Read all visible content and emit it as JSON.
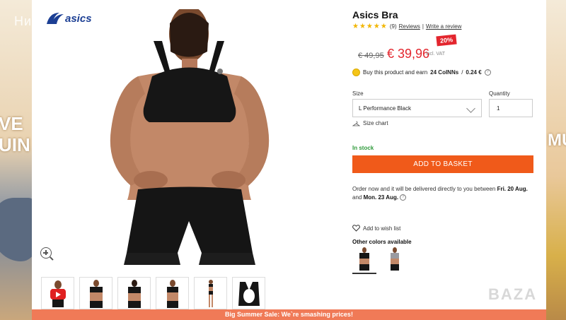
{
  "side_banners": {
    "left_promo_text": "VE\nUIN B",
    "right_promo_text": "MU"
  },
  "watermark_top_left": "Ни...",
  "watermark_bottom_right": "BAZA",
  "product": {
    "title": "Asics Bra",
    "rating_stars": "★★★★★",
    "reviews_count": "(9)",
    "reviews_link": "Reviews",
    "separator": "|",
    "write_review": "Write a review",
    "discount_badge": "20%",
    "old_price": "€ 49,95",
    "new_price": "€ 39,96",
    "vat_note": "incl. VAT",
    "earn_prefix": "Buy this product and earn",
    "earn_points": "24 CoINNs",
    "earn_separator": "/",
    "earn_value": "0.24 €",
    "size_label": "Size",
    "size_value": "L Performance Black",
    "quantity_label": "Quantity",
    "quantity_value": "1",
    "size_chart": "Size chart",
    "stock_status": "In stock",
    "add_to_basket": "ADD TO BASKET",
    "delivery_text_1": "Order now and it will be delivered directly to you between",
    "delivery_date_1": "Fri. 20 Aug.",
    "delivery_and": "and",
    "delivery_date_2": "Mon. 23 Aug.",
    "wishlist": "Add to wish list",
    "other_colors": "Other colors available"
  },
  "sale_banner": "Big Summer Sale: We`re smashing prices!",
  "colors": {
    "accent_orange": "#f05a1a",
    "price_red": "#e3262e",
    "stock_green": "#2e9a3a",
    "banner": "#f07a57",
    "star_yellow": "#f2b600"
  },
  "icons": [
    "asics-logo",
    "zoom-icon",
    "youtube-play-icon",
    "coin-icon",
    "info-icon",
    "chevron-down-icon",
    "hanger-icon",
    "heart-icon"
  ]
}
